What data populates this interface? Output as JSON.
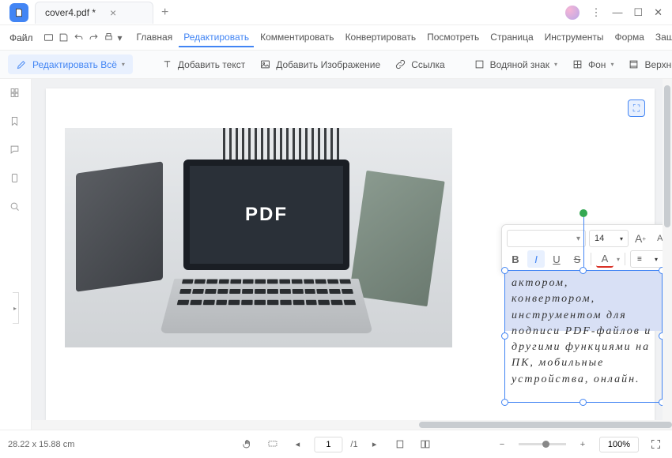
{
  "tab": {
    "title": "cover4.pdf *"
  },
  "menu": {
    "file": "Файл",
    "items": [
      "Главная",
      "Редактировать",
      "Комментировать",
      "Конвертировать",
      "Посмотреть",
      "Страница",
      "Инструменты",
      "Форма",
      "Защити"
    ],
    "active": 1
  },
  "toolbar": {
    "edit_all": "Редактировать Всё",
    "add_text": "Добавить текст",
    "add_image": "Добавить Изображение",
    "link": "Ссылка",
    "watermark": "Водяной знак",
    "background": "Фон",
    "header_footer": "Верхний и нижний коло"
  },
  "photo": {
    "label": "PDF"
  },
  "textbox": {
    "content": "актором, конвертором, инструментом для подписи PDF-файлов и другими функциями на ПК, мобильные устройства, онлайн."
  },
  "float": {
    "font_size": "14",
    "bold": "B",
    "italic": "I",
    "underline": "U",
    "strike": "S",
    "color": "A"
  },
  "status": {
    "dims": "28.22 x 15.88 cm",
    "page": "1",
    "pages": "/1",
    "zoom": "100%"
  }
}
